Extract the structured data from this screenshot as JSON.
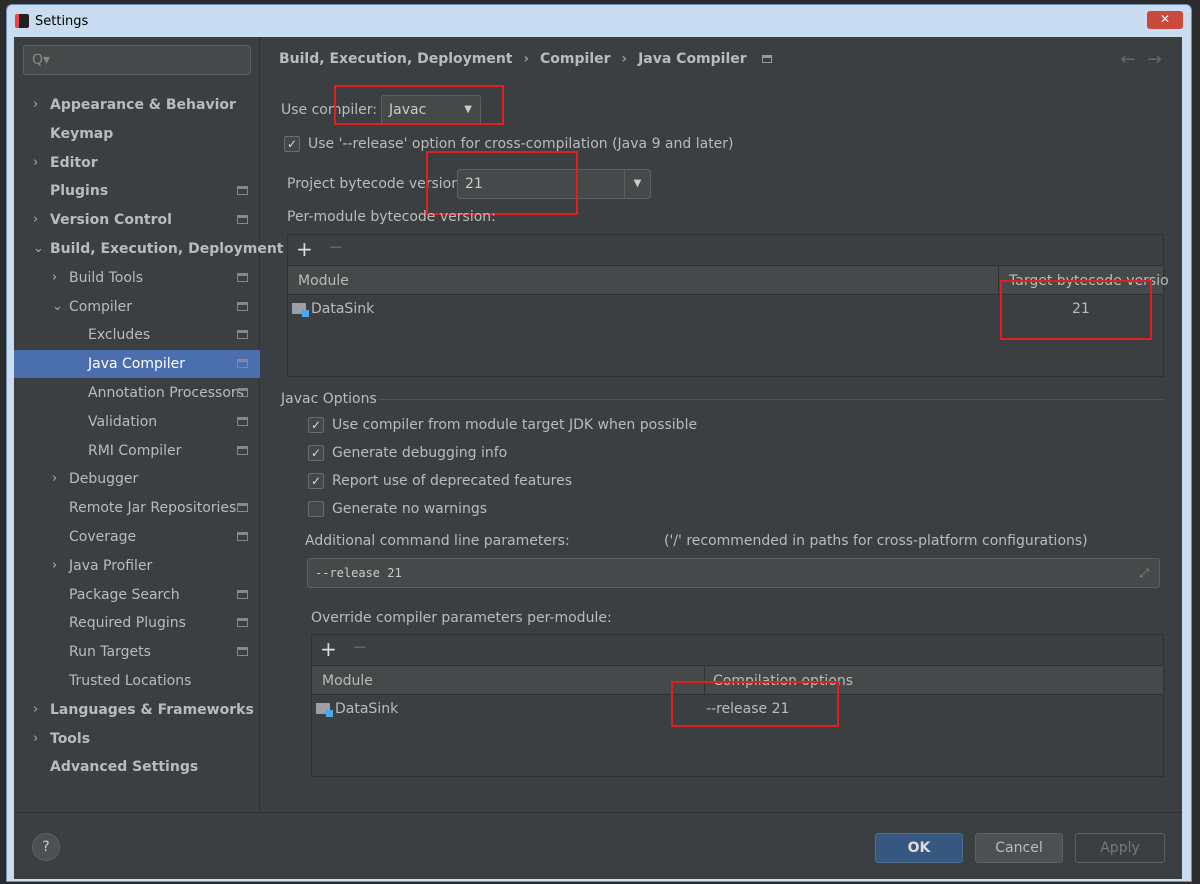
{
  "window": {
    "title": "Settings",
    "close": "✕"
  },
  "search": {
    "placeholder": "Q▾"
  },
  "tree": [
    {
      "label": "Appearance & Behavior",
      "level": 0,
      "arrow": "›",
      "bold": true
    },
    {
      "label": "Keymap",
      "level": 0,
      "bold": true
    },
    {
      "label": "Editor",
      "level": 0,
      "arrow": "›",
      "bold": true
    },
    {
      "label": "Plugins",
      "level": 0,
      "bold": true,
      "page": true
    },
    {
      "label": "Version Control",
      "level": 0,
      "arrow": "›",
      "bold": true,
      "page": true
    },
    {
      "label": "Build, Execution, Deployment",
      "level": 0,
      "arrow": "⌄",
      "bold": true
    },
    {
      "label": "Build Tools",
      "level": 1,
      "arrow": "›",
      "page": true
    },
    {
      "label": "Compiler",
      "level": 1,
      "arrow": "⌄",
      "page": true
    },
    {
      "label": "Excludes",
      "level": 2,
      "page": true
    },
    {
      "label": "Java Compiler",
      "level": 2,
      "page": true,
      "selected": true
    },
    {
      "label": "Annotation Processors",
      "level": 2,
      "page": true
    },
    {
      "label": "Validation",
      "level": 2,
      "page": true
    },
    {
      "label": "RMI Compiler",
      "level": 2,
      "page": true
    },
    {
      "label": "Debugger",
      "level": 1,
      "arrow": "›"
    },
    {
      "label": "Remote Jar Repositories",
      "level": 1,
      "page": true
    },
    {
      "label": "Coverage",
      "level": 1,
      "page": true
    },
    {
      "label": "Java Profiler",
      "level": 1,
      "arrow": "›"
    },
    {
      "label": "Package Search",
      "level": 1,
      "page": true
    },
    {
      "label": "Required Plugins",
      "level": 1,
      "page": true
    },
    {
      "label": "Run Targets",
      "level": 1,
      "page": true
    },
    {
      "label": "Trusted Locations",
      "level": 1
    },
    {
      "label": "Languages & Frameworks",
      "level": 0,
      "arrow": "›",
      "bold": true
    },
    {
      "label": "Tools",
      "level": 0,
      "arrow": "›",
      "bold": true
    },
    {
      "label": "Advanced Settings",
      "level": 0,
      "bold": true
    }
  ],
  "breadcrumb": {
    "items": [
      "Build, Execution, Deployment",
      "Compiler",
      "Java Compiler"
    ],
    "sep": "›",
    "back": "←",
    "forward": "→"
  },
  "compiler": {
    "label": "Use compiler:",
    "value": "Javac"
  },
  "release_option": {
    "label": "Use '--release' option for cross-compilation (Java 9 and later)",
    "checked": true
  },
  "bytecode": {
    "label": "Project bytecode version:",
    "value": "21"
  },
  "per_module": {
    "label": "Per-module bytecode version:",
    "add": "+",
    "remove": "−",
    "columns": [
      "Module",
      "Target bytecode version"
    ],
    "rows": [
      {
        "module": "DataSink",
        "version": "21"
      }
    ]
  },
  "javac": {
    "section": "Javac Options",
    "options": [
      {
        "label": "Use compiler from module target JDK when possible",
        "checked": true
      },
      {
        "label": "Generate debugging info",
        "checked": true
      },
      {
        "label": "Report use of deprecated features",
        "checked": true
      },
      {
        "label": "Generate no warnings",
        "checked": false
      }
    ],
    "params_label": "Additional command line parameters:",
    "params_hint": "('/' recommended in paths for cross-platform configurations)",
    "params_value": "--release 21",
    "expand": "⤢"
  },
  "override": {
    "label": "Override compiler parameters per-module:",
    "add": "+",
    "remove": "−",
    "columns": [
      "Module",
      "Compilation options"
    ],
    "rows": [
      {
        "module": "DataSink",
        "options": "--release 21"
      }
    ]
  },
  "footer": {
    "help": "?",
    "ok": "OK",
    "cancel": "Cancel",
    "apply": "Apply"
  },
  "colors": {
    "selection": "#4b6eaf",
    "ok": "#365880",
    "highlight": "#e02020"
  }
}
